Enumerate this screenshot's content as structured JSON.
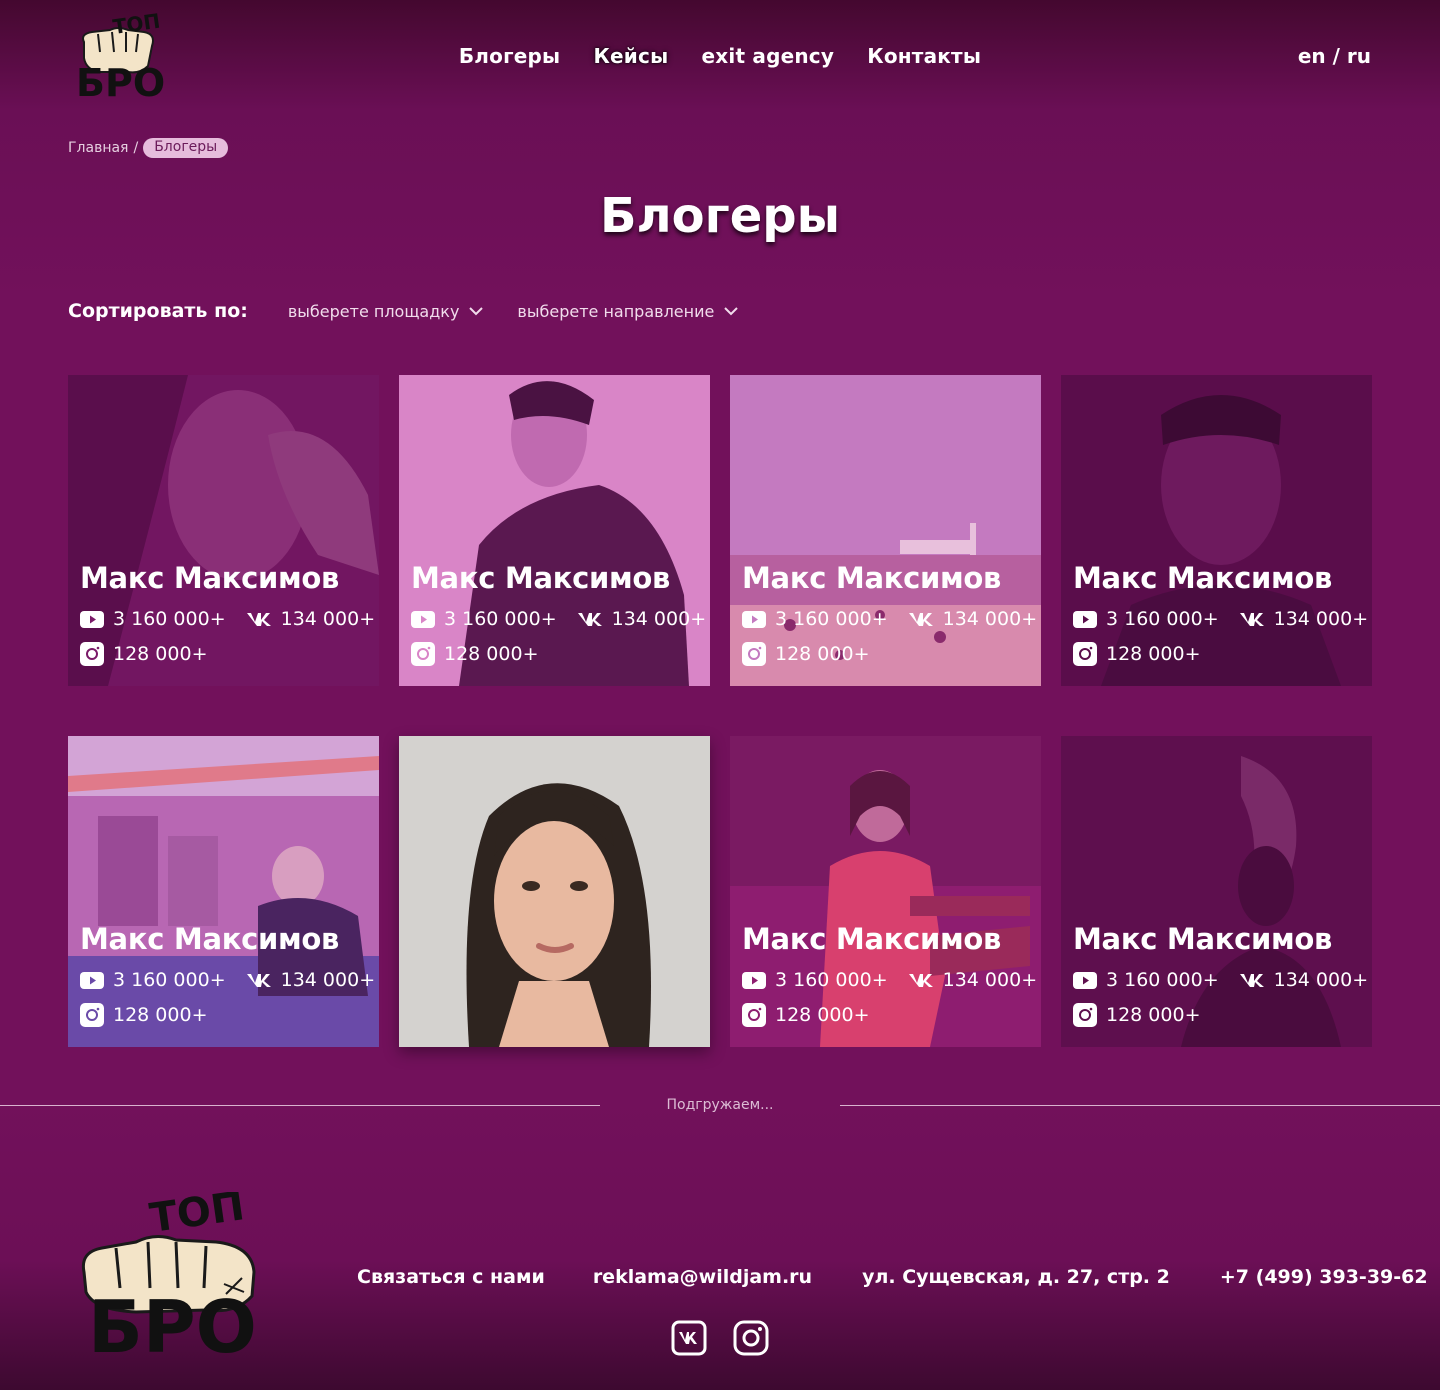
{
  "header": {
    "nav": [
      "Блогеры",
      "Кейсы",
      "exit agency",
      "Контакты"
    ],
    "lang_en": "en",
    "lang_sep": "/",
    "lang_ru": "ru"
  },
  "breadcrumb": {
    "home": "Главная",
    "sep": "/",
    "current": "Блогеры"
  },
  "page_title": "Блогеры",
  "filters": {
    "label": "Сортировать по:",
    "platform": "выберете площадку",
    "direction": "выберете направление"
  },
  "cards": [
    {
      "name": "Макс Максимов",
      "youtube": "3 160 000+",
      "vk": "134 000+",
      "instagram": "128 000+"
    },
    {
      "name": "Макс Максимов",
      "youtube": "3 160 000+",
      "vk": "134 000+",
      "instagram": "128 000+"
    },
    {
      "name": "Макс Максимов",
      "youtube": "3 160 000+",
      "vk": "134 000+",
      "instagram": "128 000+"
    },
    {
      "name": "Макс Максимов",
      "youtube": "3 160 000+",
      "vk": "134 000+",
      "instagram": "128 000+"
    },
    {
      "name": "Макс Максимов",
      "youtube": "3 160 000+",
      "vk": "134 000+",
      "instagram": "128 000+"
    },
    {
      "name": "",
      "youtube": "",
      "vk": "",
      "instagram": ""
    },
    {
      "name": "Макс Максимов",
      "youtube": "3 160 000+",
      "vk": "134 000+",
      "instagram": "128 000+"
    },
    {
      "name": "Макс Максимов",
      "youtube": "3 160 000+",
      "vk": "134 000+",
      "instagram": "128 000+"
    }
  ],
  "loader": "Подгружаем...",
  "footer": {
    "contact": "Связаться с нами",
    "email": "reklama@wildjam.ru",
    "address": "ул. Сущевская, д. 27, стр. 2",
    "phone": "+7 (499) 393-39-62"
  },
  "logo_text": {
    "top": "ТОП",
    "bottom": "БРО"
  },
  "icons": {
    "youtube": "youtube-icon",
    "vk": "vk-icon",
    "instagram": "instagram-icon",
    "dropdown": "chevron-down-icon"
  },
  "colors": {
    "background": "#72115b",
    "accent_pink": "#e6bcdc",
    "overlay": "#8a1a72"
  }
}
